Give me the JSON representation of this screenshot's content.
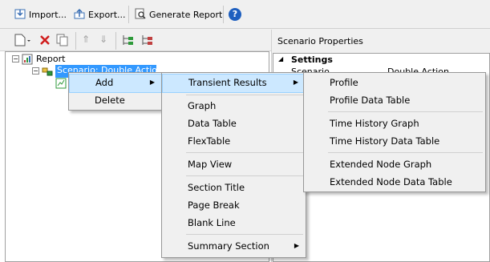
{
  "toolbar": {
    "import_label": "Import...",
    "export_label": "Export...",
    "generate_label": "Generate Report"
  },
  "right_panel": {
    "title": "Scenario Properties",
    "section_label": "Settings",
    "row_label": "Scenario",
    "row_value": "Double Action"
  },
  "tree": {
    "root_label": "Report",
    "child_label": "Scenario: Double Action"
  },
  "context_menu": {
    "items": [
      {
        "label": "Add"
      },
      {
        "label": "Delete"
      }
    ]
  },
  "add_submenu": {
    "items": [
      {
        "label": "Transient Results"
      },
      {
        "label": "Graph"
      },
      {
        "label": "Data Table"
      },
      {
        "label": "FlexTable"
      },
      {
        "label": "Map View"
      },
      {
        "label": "Section Title"
      },
      {
        "label": "Page Break"
      },
      {
        "label": "Blank Line"
      },
      {
        "label": "Summary Section"
      }
    ]
  },
  "transient_submenu": {
    "items": [
      {
        "label": "Profile"
      },
      {
        "label": "Profile Data Table"
      },
      {
        "label": "Time History Graph"
      },
      {
        "label": "Time History Data Table"
      },
      {
        "label": "Extended Node Graph"
      },
      {
        "label": "Extended Node Data Table"
      }
    ]
  },
  "colors": {
    "highlight": "#cce8ff",
    "delete_red": "#d01e1e",
    "help_blue": "#1e5fbf",
    "green": "#2e9a3a"
  }
}
